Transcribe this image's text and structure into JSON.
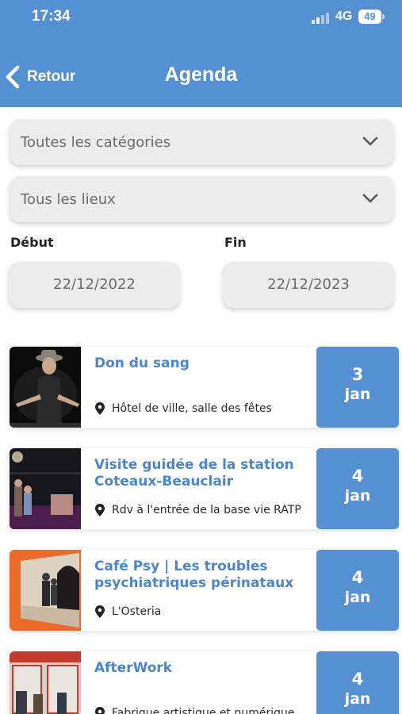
{
  "status_bar": {
    "time": "17:34",
    "network": "4G",
    "battery": "49"
  },
  "header": {
    "back_label": "Retour",
    "title": "Agenda"
  },
  "filters": {
    "category": "Toutes les catégories",
    "place": "Tous les lieux",
    "start_label": "Début",
    "end_label": "Fin",
    "start_date": "22/12/2022",
    "end_date": "22/12/2023"
  },
  "colors": {
    "primary": "#5590d2",
    "title_text": "#4a86c9",
    "field_bg": "#ececec"
  },
  "events": [
    {
      "title": "Don du sang",
      "location": "Hôtel de ville, salle des fêtes",
      "day": "3",
      "month": "jan"
    },
    {
      "title": "Visite guidée de la station Coteaux-Beauclair",
      "location": "Rdv à l'entrée de la base vie RATP",
      "day": "4",
      "month": "jan"
    },
    {
      "title": "Café Psy | Les troubles psychiatriques périnataux",
      "location": "L'Osteria",
      "day": "4",
      "month": "jan"
    },
    {
      "title": "AfterWork",
      "location": "Fabrique artistique et numérique",
      "day": "4",
      "month": "jan"
    }
  ]
}
